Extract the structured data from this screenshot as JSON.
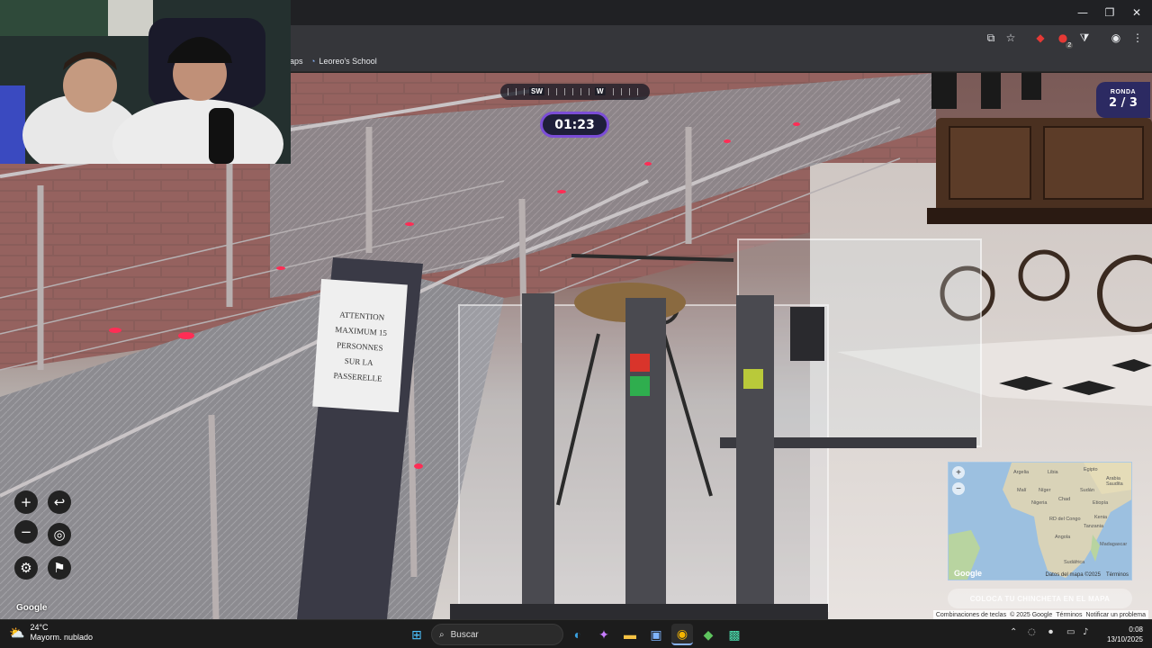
{
  "browser": {
    "window_controls": {
      "minimize": "—",
      "maximize": "❐",
      "close": "✕"
    },
    "toolbar_icons": {
      "install": "⧉",
      "star": "☆",
      "extension1": "◆",
      "extension_badge": "2",
      "extensions": "⧩",
      "profile": "◉",
      "menu": "⋮"
    },
    "bookmarks": [
      {
        "label": "aps",
        "icon": ""
      },
      {
        "label": "Leoreo's School",
        "icon": "👤"
      }
    ]
  },
  "game": {
    "compass": {
      "left_label": "SW",
      "right_label": "W"
    },
    "timer": "01:23",
    "round": {
      "label": "RONDA",
      "value": "2 / 3"
    },
    "controls": {
      "zoom_in": "+",
      "zoom_out": "−",
      "undo": "↩",
      "return_to_start": "◎",
      "settings": "⚙",
      "flag": "⚑"
    },
    "minimap": {
      "zoom_in": "+",
      "zoom_out": "−",
      "labels": [
        "Argelia",
        "Libia",
        "Egipto",
        "Arabia Saudita",
        "Malí",
        "Níger",
        "Sudán",
        "Nigeria",
        "Chad",
        "Etiopía",
        "Kenia",
        "RD del Congo",
        "Tanzania",
        "Angola",
        "Madagascar",
        "Sudáfrica"
      ],
      "google_logo": "Google",
      "data_label": "Datos del mapa ©2025",
      "terms": "Términos"
    },
    "guess_button": "COLOCA TU CHINCHETA EN EL MAPA",
    "scene_sign": [
      "ATTENTION",
      "MAXIMUM 15",
      "PERSONNES",
      "SUR LA",
      "PASSERELLE"
    ],
    "google_logo": "Google",
    "footer_links": [
      "Combinaciones de teclas",
      "© 2025 Google",
      "Términos",
      "Notificar un problema"
    ]
  },
  "taskbar": {
    "weather": {
      "temp": "24°C",
      "desc": "Mayorm. nublado"
    },
    "search_placeholder": "Buscar",
    "time": "0:08",
    "date": "13/10/2025"
  },
  "colors": {
    "timer_border": "#7b4dd6",
    "round_bg": "#2c2a62",
    "taskbar_bg": "#1c1c1c"
  }
}
